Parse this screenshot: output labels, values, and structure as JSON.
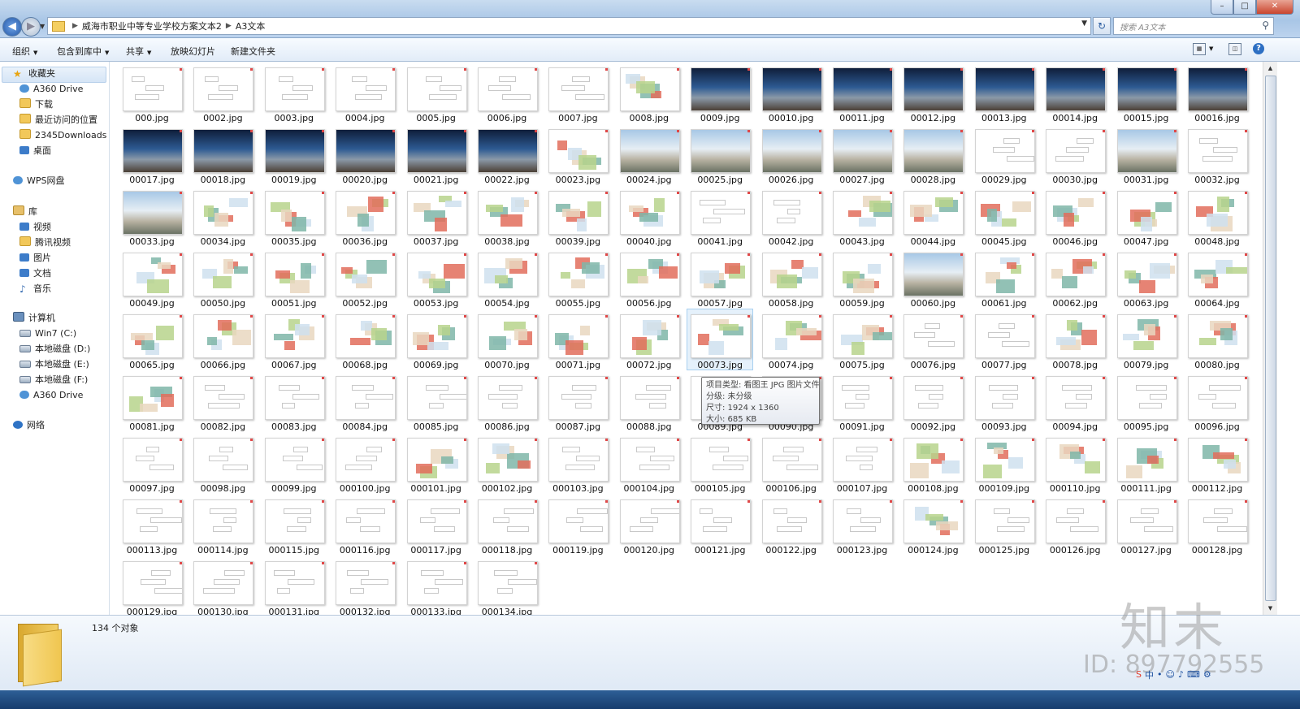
{
  "titlebar": {
    "breadcrumbs": [
      "威海市职业中等专业学校方案文本2",
      "A3文本"
    ],
    "search_placeholder": "搜索 A3文本",
    "minimize": "–",
    "maximize": "□",
    "close": "✕"
  },
  "toolbar": {
    "organize": "组织",
    "include_in_library": "包含到库中",
    "share": "共享",
    "slideshow": "放映幻灯片",
    "new_folder": "新建文件夹",
    "help": "?"
  },
  "sidebar": {
    "favorites_header": "收藏夹",
    "favorites": [
      "A360 Drive",
      "下载",
      "最近访问的位置",
      "2345Downloads",
      "桌面"
    ],
    "wps": "WPS网盘",
    "libraries_header": "库",
    "libraries": [
      "视频",
      "腾讯视频",
      "图片",
      "文档",
      "音乐"
    ],
    "computer_header": "计算机",
    "drives": [
      "Win7 (C:)",
      "本地磁盘 (D:)",
      "本地磁盘 (E:)",
      "本地磁盘 (F:)",
      "A360 Drive"
    ],
    "network": "网络"
  },
  "files": [
    "000.jpg",
    "0002.jpg",
    "0003.jpg",
    "0004.jpg",
    "0005.jpg",
    "0006.jpg",
    "0007.jpg",
    "0008.jpg",
    "0009.jpg",
    "00010.jpg",
    "00011.jpg",
    "00012.jpg",
    "00013.jpg",
    "00014.jpg",
    "00015.jpg",
    "00016.jpg",
    "00017.jpg",
    "00018.jpg",
    "00019.jpg",
    "00020.jpg",
    "00021.jpg",
    "00022.jpg",
    "00023.jpg",
    "00024.jpg",
    "00025.jpg",
    "00026.jpg",
    "00027.jpg",
    "00028.jpg",
    "00029.jpg",
    "00030.jpg",
    "00031.jpg",
    "00032.jpg",
    "00033.jpg",
    "00034.jpg",
    "00035.jpg",
    "00036.jpg",
    "00037.jpg",
    "00038.jpg",
    "00039.jpg",
    "00040.jpg",
    "00041.jpg",
    "00042.jpg",
    "00043.jpg",
    "00044.jpg",
    "00045.jpg",
    "00046.jpg",
    "00047.jpg",
    "00048.jpg",
    "00049.jpg",
    "00050.jpg",
    "00051.jpg",
    "00052.jpg",
    "00053.jpg",
    "00054.jpg",
    "00055.jpg",
    "00056.jpg",
    "00057.jpg",
    "00058.jpg",
    "00059.jpg",
    "00060.jpg",
    "00061.jpg",
    "00062.jpg",
    "00063.jpg",
    "00064.jpg",
    "00065.jpg",
    "00066.jpg",
    "00067.jpg",
    "00068.jpg",
    "00069.jpg",
    "00070.jpg",
    "00071.jpg",
    "00072.jpg",
    "00073.jpg",
    "00074.jpg",
    "00075.jpg",
    "00076.jpg",
    "00077.jpg",
    "00078.jpg",
    "00079.jpg",
    "00080.jpg",
    "00081.jpg",
    "00082.jpg",
    "00083.jpg",
    "00084.jpg",
    "00085.jpg",
    "00086.jpg",
    "00087.jpg",
    "00088.jpg",
    "00089.jpg",
    "00090.jpg",
    "00091.jpg",
    "00092.jpg",
    "00093.jpg",
    "00094.jpg",
    "00095.jpg",
    "00096.jpg",
    "00097.jpg",
    "00098.jpg",
    "00099.jpg",
    "000100.jpg",
    "000101.jpg",
    "000102.jpg",
    "000103.jpg",
    "000104.jpg",
    "000105.jpg",
    "000106.jpg",
    "000107.jpg",
    "000108.jpg",
    "000109.jpg",
    "000110.jpg",
    "000111.jpg",
    "000112.jpg",
    "000113.jpg",
    "000114.jpg",
    "000115.jpg",
    "000116.jpg",
    "000117.jpg",
    "000118.jpg",
    "000119.jpg",
    "000120.jpg",
    "000121.jpg",
    "000122.jpg",
    "000123.jpg",
    "000124.jpg",
    "000125.jpg",
    "000126.jpg",
    "000127.jpg",
    "000128.jpg",
    "000129.jpg",
    "000130.jpg",
    "000131.jpg",
    "000132.jpg",
    "000133.jpg",
    "000134.jpg"
  ],
  "thumb_kinds": "bbbbbbbpddddddddddddddpcccccbbcbcpppppppbbpppppppppppppppppcpppppppppppppppbbppppbbbbbbbbbbbbbbbbbbbppbbbbbpppppbbbbbbbbbbbpbbbbbbbbbbbbbbbbbbbbbbbbbbbbbbbbbbbbbbbbbbbbbbbbbbbbbbbbbbbbbbbbbbb",
  "selected_file": "00073.jpg",
  "tooltip": {
    "type": "项目类型: 看图王 JPG 图片文件",
    "rating": "分级: 未分级",
    "size": "尺寸: 1924 x 1360",
    "filesize": "大小: 685 KB"
  },
  "details": {
    "count": "134 个对象"
  },
  "watermark": {
    "logo": "知末",
    "id": "ID: 897792555"
  }
}
